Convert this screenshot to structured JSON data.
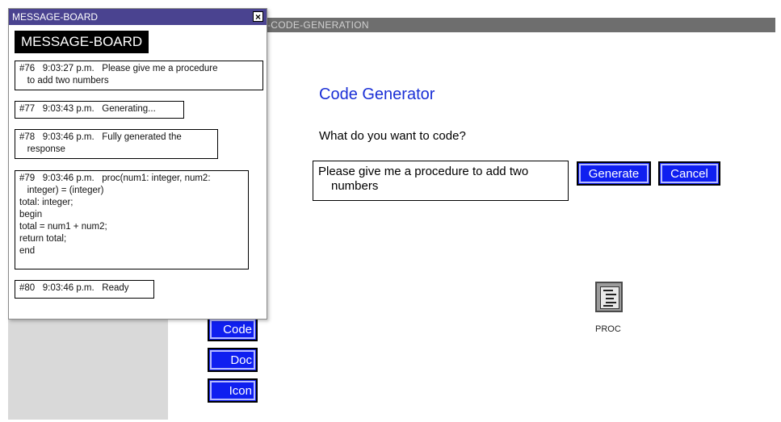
{
  "main_window": {
    "title": "2-CODE-GENERATION",
    "heading": "Code Generator",
    "question": "What do you want to code?",
    "input_line1": "Please give me a procedure to add two",
    "input_line2": "numbers",
    "generate_label": "Generate",
    "cancel_label": "Cancel"
  },
  "side_buttons": {
    "code": "Code",
    "doc": "Doc",
    "icon": "Icon"
  },
  "proc_icon": {
    "icon": "procedure-icon",
    "label": "PROC"
  },
  "message_board": {
    "window_title": "MESSAGE-BOARD",
    "header": "MESSAGE-BOARD",
    "close_icon": "close-icon",
    "messages": [
      {
        "text": "#76   9:03:27 p.m.   Please give me a procedure\n   to add two numbers"
      },
      {
        "text": "#77   9:03:43 p.m.   Generating..."
      },
      {
        "text": "#78   9:03:46 p.m.   Fully generated the\n   response"
      },
      {
        "text": "#79   9:03:46 p.m.   proc(num1: integer, num2:\n   integer) = (integer)\ntotal: integer;\nbegin\ntotal = num1 + num2;\nreturn total;\nend"
      },
      {
        "text": "#80   9:03:46 p.m.   Ready"
      }
    ]
  },
  "colors": {
    "button_blue": "#0f1ff0",
    "heading_blue": "#1a2fd6",
    "titlebar_purple": "#4a4390"
  }
}
